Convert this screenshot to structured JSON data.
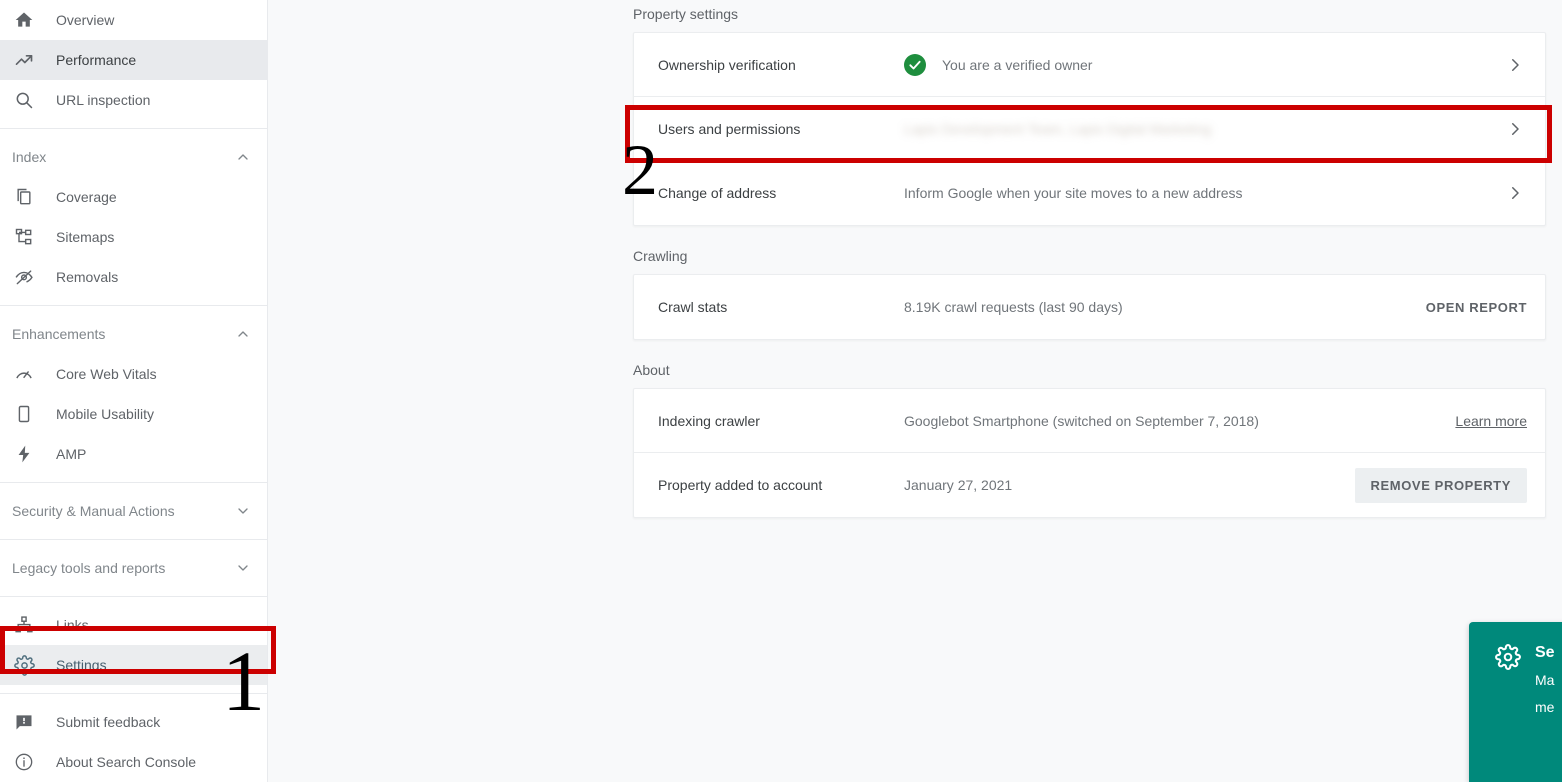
{
  "sidebar": {
    "primary": [
      {
        "label": "Overview",
        "icon": "home-icon",
        "active": false
      },
      {
        "label": "Performance",
        "icon": "trending-up-icon",
        "active": true
      },
      {
        "label": "URL inspection",
        "icon": "search-icon",
        "active": false
      }
    ],
    "groups": [
      {
        "title": "Index",
        "chevron": "chevron-up-icon",
        "items": [
          {
            "label": "Coverage",
            "icon": "coverage-documents-icon"
          },
          {
            "label": "Sitemaps",
            "icon": "sitemap-hierarchy-icon"
          },
          {
            "label": "Removals",
            "icon": "eye-slash-icon"
          }
        ]
      },
      {
        "title": "Enhancements",
        "chevron": "chevron-up-icon",
        "items": [
          {
            "label": "Core Web Vitals",
            "icon": "speedometer-icon"
          },
          {
            "label": "Mobile Usability",
            "icon": "mobile-phone-icon"
          },
          {
            "label": "AMP",
            "icon": "lightning-bolt-icon"
          }
        ]
      }
    ],
    "collapsed_groups": [
      {
        "title": "Security & Manual Actions",
        "chevron": "chevron-down-icon"
      },
      {
        "title": "Legacy tools and reports",
        "chevron": "chevron-down-icon"
      }
    ],
    "footer": [
      {
        "label": "Links",
        "icon": "links-hierarchy-icon",
        "highlighted": false
      },
      {
        "label": "Settings",
        "icon": "gear-icon",
        "highlighted": true
      }
    ],
    "bottom": [
      {
        "label": "Submit feedback",
        "icon": "feedback-icon"
      },
      {
        "label": "About Search Console",
        "icon": "info-circle-icon"
      }
    ]
  },
  "main": {
    "sections": [
      {
        "title": "Property settings",
        "rows": [
          {
            "label": "Ownership verification",
            "value": "You are a verified owner",
            "status_icon": "green-check-circle-icon",
            "trailing": "chevron-right-icon"
          },
          {
            "label": "Users and permissions",
            "value": "Lapis Development Team, Lapis Digital Marketing",
            "blurred": true,
            "trailing": "chevron-right-icon"
          },
          {
            "label": "Change of address",
            "value": "Inform Google when your site moves to a new address",
            "trailing": "chevron-right-icon"
          }
        ]
      },
      {
        "title": "Crawling",
        "rows": [
          {
            "label": "Crawl stats",
            "value": "8.19K crawl requests (last 90 days)",
            "action": "OPEN REPORT"
          }
        ]
      },
      {
        "title": "About",
        "rows": [
          {
            "label": "Indexing crawler",
            "value": "Googlebot Smartphone (switched on September 7, 2018)",
            "link": "Learn more"
          },
          {
            "label": "Property added to account",
            "value": "January 27, 2021",
            "button": "REMOVE PROPERTY"
          }
        ]
      }
    ]
  },
  "feedback_widget": {
    "icon": "gear-icon",
    "title": "Se",
    "body_line1": "Ma",
    "body_line2": "me"
  },
  "annotations": {
    "step1": "1",
    "step2": "2",
    "color": "#cc0000"
  },
  "colors": {
    "accent_teal": "#00897b",
    "verified_green": "#1e8e3e",
    "annotation_red": "#cc0000",
    "sidebar_active": "#e8eaed",
    "page_background": "#f8f9fa"
  }
}
